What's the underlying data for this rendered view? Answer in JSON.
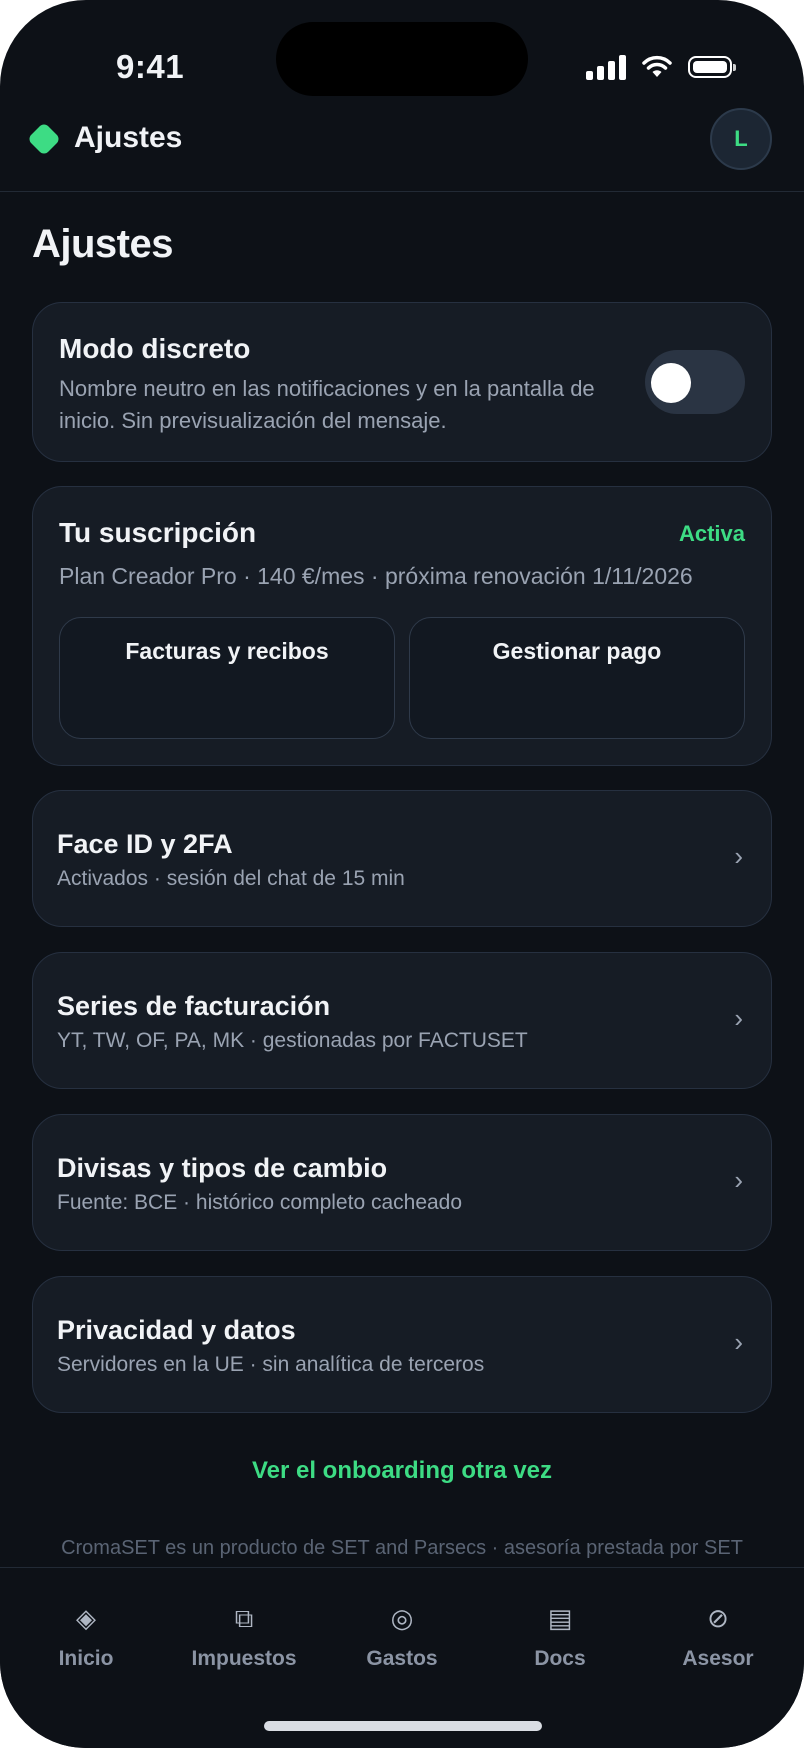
{
  "status_bar": {
    "time": "9:41"
  },
  "header": {
    "title": "Ajustes",
    "avatar_initial": "L"
  },
  "page": {
    "title": "Ajustes"
  },
  "discreet_mode": {
    "title": "Modo discreto",
    "description": "Nombre neutro en las notificaciones y en la pantalla de inicio. Sin previsualización del mensaje.",
    "enabled": false
  },
  "subscription": {
    "title": "Tu suscripción",
    "status": "Activa",
    "plan": "Plan Creador Pro · 140 €/mes · próxima renovación 1/11/2026",
    "invoices_label": "Facturas y recibos",
    "manage_label": "Gestionar pago"
  },
  "settings": [
    {
      "title": "Face ID y 2FA",
      "subtitle": "Activados · sesión del chat de 15 min"
    },
    {
      "title": "Series de facturación",
      "subtitle": "YT, TW, OF, PA, MK · gestionadas por FACTUSET"
    },
    {
      "title": "Divisas y tipos de cambio",
      "subtitle": "Fuente: BCE · histórico completo cacheado"
    },
    {
      "title": "Privacidad y datos",
      "subtitle": "Servidores en la UE · sin analítica de terceros"
    }
  ],
  "chevron": "›",
  "onboarding_link": "Ver el onboarding otra vez",
  "footer": "CromaSET es un producto de SET and Parsecs · asesoría prestada por SET",
  "tabs": [
    {
      "label": "Inicio",
      "icon": "diamond-icon",
      "glyph": "◈"
    },
    {
      "label": "Impuestos",
      "icon": "layers-icon",
      "glyph": "⧉"
    },
    {
      "label": "Gastos",
      "icon": "coin-icon",
      "glyph": "◎"
    },
    {
      "label": "Docs",
      "icon": "document-icon",
      "glyph": "▤"
    },
    {
      "label": "Asesor",
      "icon": "compass-icon",
      "glyph": "⊘"
    }
  ],
  "colors": {
    "background": "#0d1117",
    "card": "#161c25",
    "accent": "#3ddc84",
    "muted_text": "#9aa3b2"
  }
}
